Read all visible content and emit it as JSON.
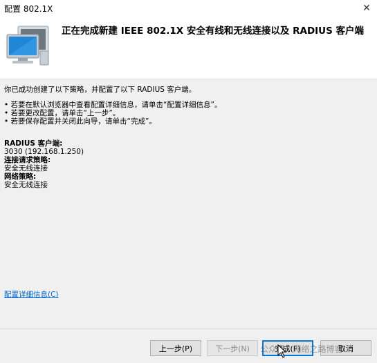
{
  "window": {
    "title": "配置 802.1X",
    "close_glyph": "✕"
  },
  "header": {
    "heading": "正在完成新建 IEEE 802.1X 安全有线和无线连接以及 RADIUS 客户端",
    "icon": "network-computer-icon"
  },
  "content": {
    "intro": "你已成功创建了以下策略，并配置了以下 RADIUS 客户端。",
    "bullets": [
      "• 若要在默认浏览器中查看配置详细信息，请单击“配置详细信息”。",
      "• 若要更改配置，请单击“上一步”。",
      "• 若要保存配置并关闭此向导，请单击“完成”。"
    ],
    "radius_label": "RADIUS 客户端:",
    "radius_value": "3030 (192.168.1.250)",
    "connection_policy_label": "连接请求策略:",
    "connection_policy_value": "安全无线连接",
    "network_policy_label": "网络策略:",
    "network_policy_value": "安全无线连接",
    "details_link": "配置详细信息(C)"
  },
  "buttons": {
    "back": "上一步(P)",
    "next": "下一步(N)",
    "finish": "完成(F)",
    "cancel": "取消"
  },
  "watermark": "公众号 · 网络之路博客",
  "colors": {
    "link": "#0066cc",
    "default_button_border": "#0078d7"
  }
}
